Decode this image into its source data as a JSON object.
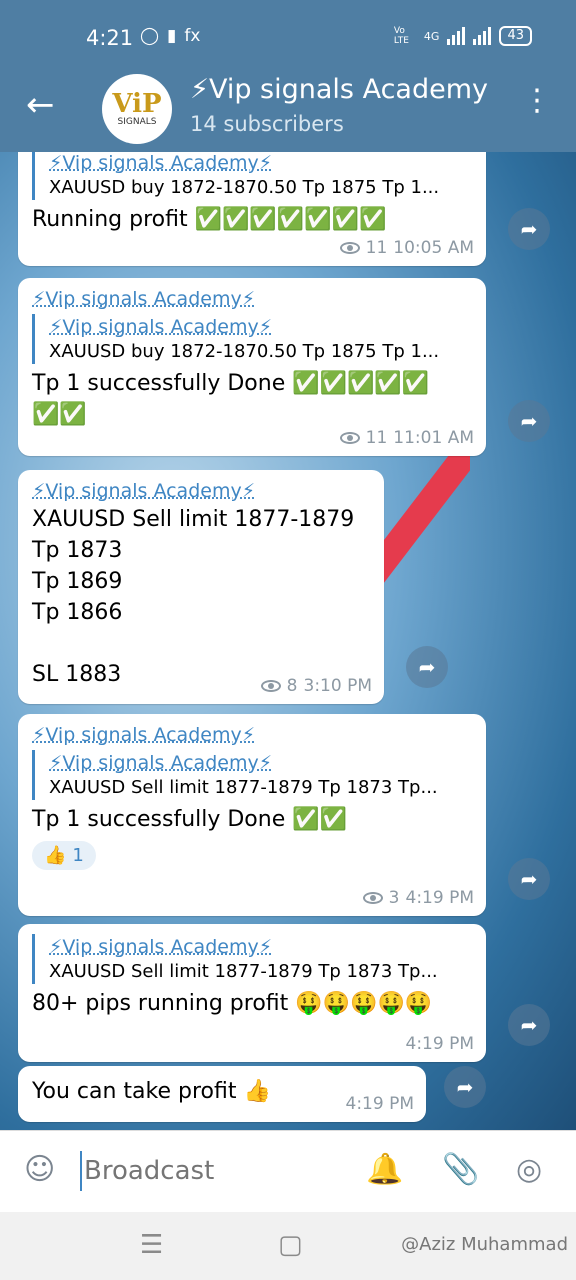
{
  "status": {
    "time": "4:21",
    "battery": "43",
    "network": "4G",
    "volte": "Vo LTE"
  },
  "header": {
    "title": "⚡Vip signals Academy",
    "subtitle": "14 subscribers",
    "avatar_text": "ViP",
    "avatar_sub": "SIGNALS"
  },
  "messages": [
    {
      "quote_name": "⚡Vip signals Academy⚡",
      "quote_text": "XAUUSD buy 1872-1870.50 Tp 1875 Tp 1...",
      "text": "Running profit ✅✅✅✅✅✅✅",
      "views": "11",
      "time": "10:05 AM"
    },
    {
      "sender": "⚡Vip signals Academy⚡",
      "quote_name": "⚡Vip signals Academy⚡",
      "quote_text": "XAUUSD buy 1872-1870.50 Tp 1875 Tp 1...",
      "text": "Tp 1 successfully Done ✅✅✅✅✅\n✅✅",
      "views": "11",
      "time": "11:01 AM"
    },
    {
      "sender": "⚡Vip signals Academy⚡",
      "text": "XAUUSD Sell limit 1877-1879\nTp 1873\nTp 1869\nTp 1866\n\nSL 1883",
      "views": "8",
      "time": "3:10 PM"
    },
    {
      "sender": "⚡Vip signals Academy⚡",
      "quote_name": "⚡Vip signals Academy⚡",
      "quote_text": "XAUUSD Sell limit 1877-1879 Tp 1873 Tp...",
      "text": "Tp 1 successfully Done ✅✅",
      "reaction": "👍",
      "reaction_count": "1",
      "views": "3",
      "time": "4:19 PM"
    },
    {
      "quote_name": "⚡Vip signals Academy⚡",
      "quote_text": "XAUUSD Sell limit 1877-1879 Tp 1873 Tp...",
      "text": "80+ pips running profit 🤑🤑🤑🤑🤑",
      "time": "4:19 PM"
    },
    {
      "text": "You can take profit 👍",
      "time": "4:19 PM"
    }
  ],
  "composer": {
    "placeholder": "Broadcast"
  },
  "watermark": "@Aziz Muhammad"
}
